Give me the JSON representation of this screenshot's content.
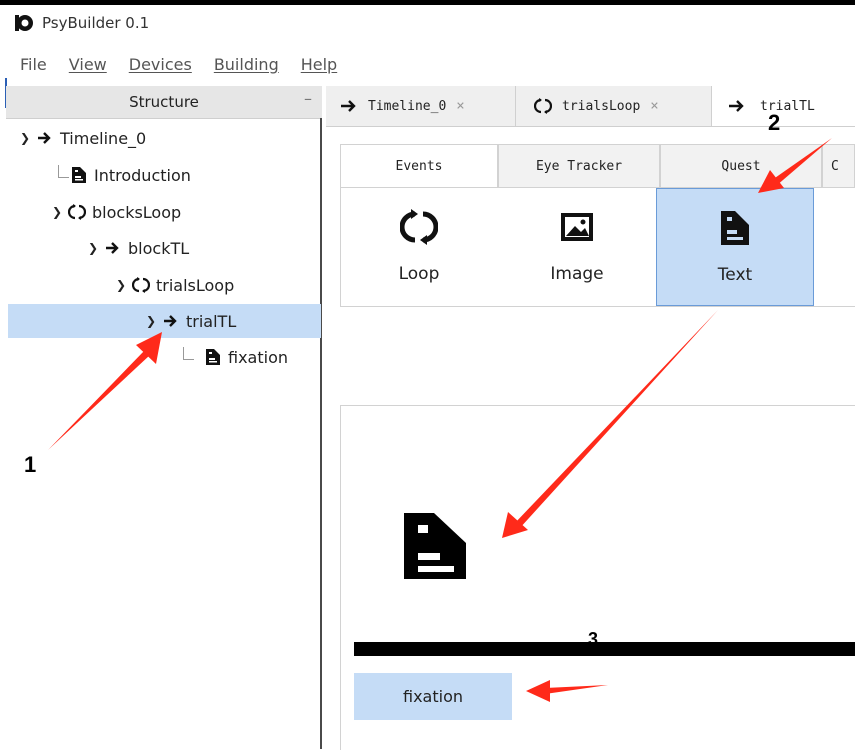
{
  "app": {
    "title": "PsyBuilder 0.1"
  },
  "menu": {
    "file": "File",
    "view": "View",
    "devices": "Devices",
    "building": "Building",
    "help": "Help"
  },
  "structure": {
    "header": "Structure",
    "minimize": "–",
    "tree": [
      {
        "label": "Timeline_0",
        "icon": "arrow-right-icon",
        "expanded": true
      },
      {
        "label": "Introduction",
        "icon": "text-document-icon"
      },
      {
        "label": "blocksLoop",
        "icon": "loop-icon",
        "expanded": true
      },
      {
        "label": "blockTL",
        "icon": "arrow-right-icon",
        "expanded": true
      },
      {
        "label": "trialsLoop",
        "icon": "loop-icon",
        "expanded": true
      },
      {
        "label": "trialTL",
        "icon": "arrow-right-icon",
        "expanded": true,
        "selected": true
      },
      {
        "label": "fixation",
        "icon": "text-document-icon"
      }
    ]
  },
  "tabs": [
    {
      "label": "Timeline_0",
      "close": "×"
    },
    {
      "label": "trialsLoop",
      "close": "×"
    },
    {
      "label": "trialTL"
    }
  ],
  "events_panel": {
    "tabs": [
      "Events",
      "Eye Tracker",
      "Quest",
      "C"
    ],
    "tools": [
      {
        "label": "Loop",
        "icon": "loop-icon"
      },
      {
        "label": "Image",
        "icon": "image-icon"
      },
      {
        "label": "Text",
        "icon": "text-document-icon",
        "selected": true
      }
    ]
  },
  "timeline": {
    "chip_label": "fixation"
  },
  "annotations": {
    "n1": "1",
    "n2": "2",
    "n3": "3"
  },
  "colors": {
    "selection": "#c5dcf6",
    "arrow": "#ff2a1a"
  }
}
